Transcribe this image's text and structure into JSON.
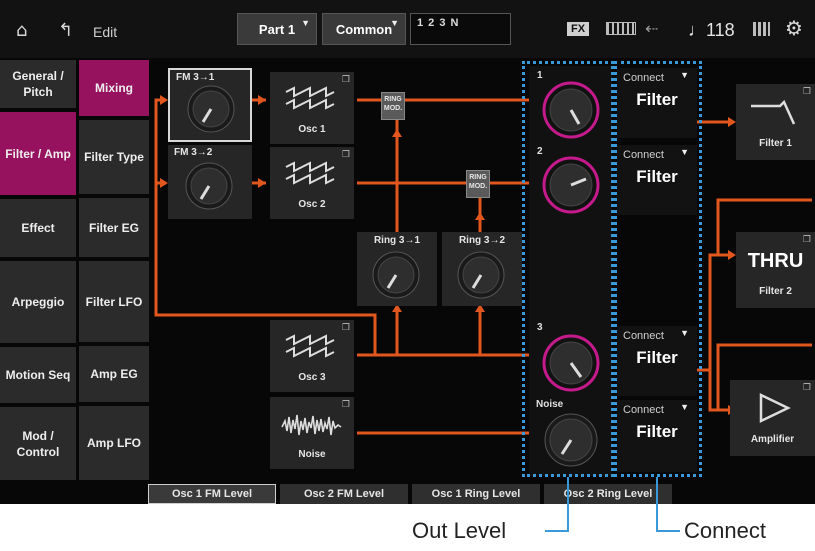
{
  "header": {
    "edit_label": "Edit",
    "part_select": "Part 1",
    "common_select": "Common",
    "part_indicator": "1 2 3 N",
    "fx_badge": "FX",
    "tempo": "♩118"
  },
  "left_tabs": [
    {
      "label": "General / Pitch",
      "selected": false
    },
    {
      "label": "Filter / Amp",
      "selected": true
    },
    {
      "label": "Effect",
      "selected": false
    },
    {
      "label": "Arpeggio",
      "selected": false
    },
    {
      "label": "Motion Seq",
      "selected": false
    },
    {
      "label": "Mod / Control",
      "selected": false
    }
  ],
  "sub_tabs": [
    {
      "label": "Mixing",
      "selected": true
    },
    {
      "label": "Filter Type",
      "selected": false
    },
    {
      "label": "Filter EG",
      "selected": false
    },
    {
      "label": "Filter LFO",
      "selected": false
    },
    {
      "label": "Amp EG",
      "selected": false
    },
    {
      "label": "Amp LFO",
      "selected": false
    }
  ],
  "blocks": {
    "fm31": "FM 3→1",
    "fm32": "FM 3→2",
    "osc1": "Osc 1",
    "osc2": "Osc 2",
    "osc3": "Osc 3",
    "noise": "Noise",
    "ring31": "Ring 3→1",
    "ring32": "Ring 3→2",
    "ring_mod": "RING MOD."
  },
  "out_levels": [
    "1",
    "2",
    "3",
    "Noise"
  ],
  "connect": [
    {
      "label": "Connect",
      "value": "Filter"
    },
    {
      "label": "Connect",
      "value": "Filter"
    },
    {
      "label": "Connect",
      "value": "Filter"
    },
    {
      "label": "Connect",
      "value": "Filter"
    }
  ],
  "filter1": {
    "label": "Filter 1"
  },
  "filter2": {
    "label": "Filter 2",
    "value": "THRU"
  },
  "amplifier": {
    "label": "Amplifier"
  },
  "bottom_tabs": [
    "Osc 1 FM Level",
    "Osc 2 FM Level",
    "Osc 1 Ring Level",
    "Osc 2 Ring Level"
  ],
  "annotations": {
    "out_level": "Out Level",
    "connect": "Connect"
  },
  "colors": {
    "accent": "#96125e",
    "wire": "#e2571e",
    "highlight": "#3a9ad9",
    "knob_ring": "#c41a8c"
  }
}
